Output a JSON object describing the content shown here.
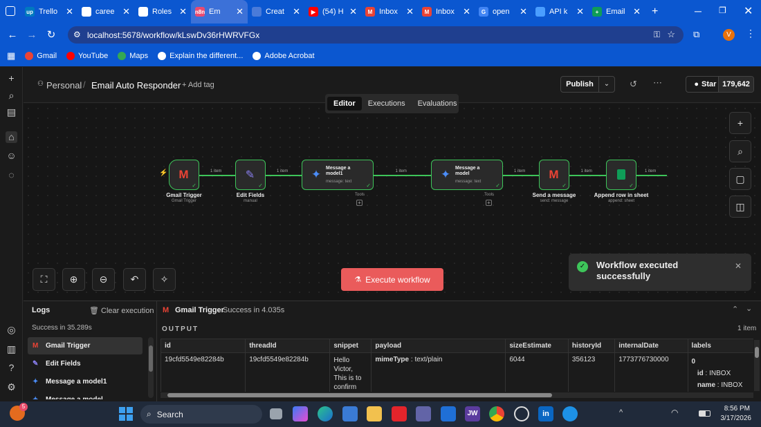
{
  "browser": {
    "tabs": [
      {
        "label": "Trello",
        "fav_color": "#0079bf",
        "fav_text": "up"
      },
      {
        "label": "caree",
        "fav_color": "#ffffff",
        "fav_text": ""
      },
      {
        "label": "Roles",
        "fav_color": "#ffffff",
        "fav_text": ""
      },
      {
        "label": "Em",
        "fav_color": "#ea4b71",
        "fav_text": "n8n",
        "active": true
      },
      {
        "label": "Creat",
        "fav_color": "#4a7bd9",
        "fav_text": ""
      },
      {
        "label": "(54) H",
        "fav_color": "#ff0000",
        "fav_text": "▶"
      },
      {
        "label": "Inbox",
        "fav_color": "#ea4335",
        "fav_text": "M"
      },
      {
        "label": "Inbox",
        "fav_color": "#ea4335",
        "fav_text": "M"
      },
      {
        "label": "open",
        "fav_color": "#4285f4",
        "fav_text": "G"
      },
      {
        "label": "API k",
        "fav_color": "#4a9eff",
        "fav_text": ""
      },
      {
        "label": "Email",
        "fav_color": "#0f9d58",
        "fav_text": "+"
      }
    ],
    "new_tab_label": "+",
    "url": "localhost:5678/workflow/kLswDv36rHWRVFGx",
    "profile_initial": "V",
    "bookmarks": [
      {
        "label": "Gmail",
        "color": "#ea4335"
      },
      {
        "label": "YouTube",
        "color": "#ff0000"
      },
      {
        "label": "Maps",
        "color": "#34a853"
      },
      {
        "label": "Explain the different...",
        "color": "#ffffff"
      },
      {
        "label": "Adobe Acrobat",
        "color": "#ffffff"
      }
    ]
  },
  "header": {
    "project": "Personal",
    "workflow_name": "Email Auto Responder",
    "add_tag": "+ Add tag",
    "publish": "Publish",
    "star": "Star",
    "star_count": "179,642",
    "tabs": [
      "Editor",
      "Executions",
      "Evaluations"
    ],
    "active_tab": "Editor"
  },
  "canvas": {
    "nodes": [
      {
        "title": "Gmail Trigger",
        "subtitle": "Gmail Trigger",
        "icon": "gmail-icon"
      },
      {
        "title": "Edit Fields",
        "subtitle": "manual",
        "icon": "pencil-icon"
      },
      {
        "title": "Message a model1",
        "subtitle": "message: text",
        "icon": "gemini-icon",
        "tools": "Tools"
      },
      {
        "title": "Message a model",
        "subtitle": "message: text",
        "icon": "gemini-icon",
        "tools": "Tools"
      },
      {
        "title": "Send a message",
        "subtitle": "send: message",
        "icon": "gmail-icon"
      },
      {
        "title": "Append row in sheet",
        "subtitle": "append: sheet",
        "icon": "sheets-icon"
      }
    ],
    "connection_label": "1 item",
    "execute_button": "Execute workflow",
    "toast": "Workflow executed successfully"
  },
  "logs": {
    "title": "Logs",
    "clear": "Clear execution",
    "summary": "Success in 35.289s",
    "items": [
      "Gmail Trigger",
      "Edit Fields",
      "Message a model1",
      "Message a model"
    ],
    "selected": "Gmail Trigger",
    "detail_title": "Gmail Trigger",
    "detail_status": "Success in 4.035s",
    "output_label": "OUTPUT",
    "item_count": "1 item",
    "columns": [
      "id",
      "threadId",
      "snippet",
      "payload",
      "sizeEstimate",
      "historyId",
      "internalDate",
      "labels"
    ],
    "row": {
      "id": "19cfd5549e82284b",
      "threadId": "19cfd5549e82284b",
      "snippet": "Hello Victor, This is to confirm the",
      "payload_key": "mimeType",
      "payload_val": "text/plain",
      "sizeEstimate": "6044",
      "historyId": "356123",
      "internalDate": "1773776730000",
      "labels_index": "0",
      "labels_id_key": "id",
      "labels_id_val": "INBOX",
      "labels_name_key": "name",
      "labels_name_val": "INBOX"
    }
  },
  "taskbar": {
    "search": "Search",
    "time": "8:56 PM",
    "date": "3/17/2026",
    "badge": "5"
  }
}
